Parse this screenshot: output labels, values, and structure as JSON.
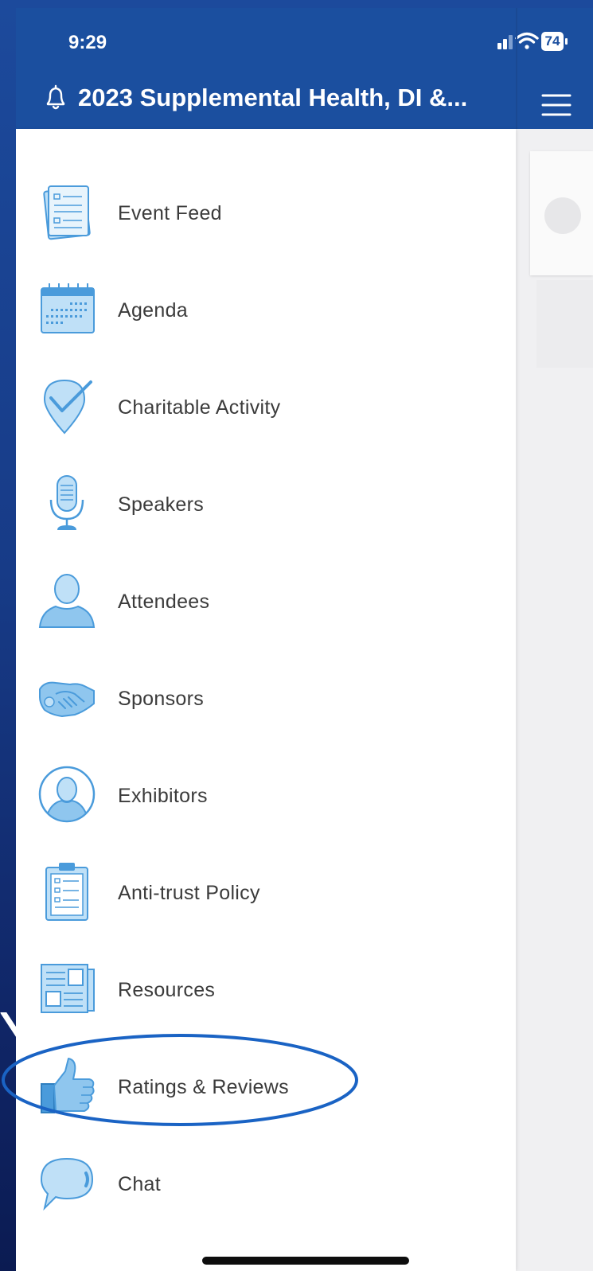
{
  "status_bar": {
    "time": "9:29",
    "battery": "74"
  },
  "header": {
    "title": "2023 Supplemental Health, DI &..."
  },
  "menu": {
    "items": [
      {
        "label": "Event Feed",
        "icon": "event-feed-icon"
      },
      {
        "label": "Agenda",
        "icon": "calendar-icon"
      },
      {
        "label": "Charitable Activity",
        "icon": "map-pin-check-icon"
      },
      {
        "label": "Speakers",
        "icon": "microphone-icon"
      },
      {
        "label": "Attendees",
        "icon": "person-icon"
      },
      {
        "label": "Sponsors",
        "icon": "handshake-icon"
      },
      {
        "label": "Exhibitors",
        "icon": "person-circle-icon"
      },
      {
        "label": "Anti-trust Policy",
        "icon": "clipboard-icon"
      },
      {
        "label": "Resources",
        "icon": "newspaper-icon"
      },
      {
        "label": "Ratings & Reviews",
        "icon": "thumbs-up-icon"
      },
      {
        "label": "Chat",
        "icon": "chat-bubble-icon"
      }
    ]
  },
  "colors": {
    "header_blue": "#1b4f9f",
    "icon_fill": "#bfe0f7",
    "icon_stroke": "#4a9bdb",
    "highlight": "#1a63c4"
  }
}
